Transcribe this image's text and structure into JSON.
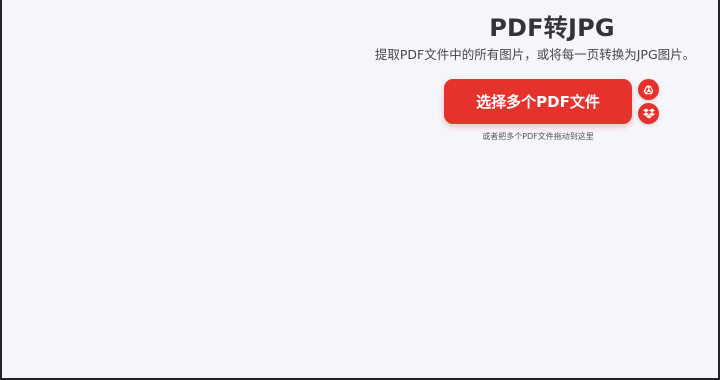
{
  "page": {
    "title": "PDF转JPG",
    "subtitle": "提取PDF文件中的所有图片，或将每一页转换为JPG图片。"
  },
  "upload": {
    "select_button_label": "选择多个PDF文件",
    "drop_hint": "或者把多个PDF文件拖动到这里",
    "cloud_sources": [
      {
        "icon": "google-drive-icon"
      },
      {
        "icon": "dropbox-icon"
      }
    ]
  },
  "colors": {
    "accent": "#e5322d",
    "background": "#f5f5fa",
    "title_text": "#33333b"
  }
}
